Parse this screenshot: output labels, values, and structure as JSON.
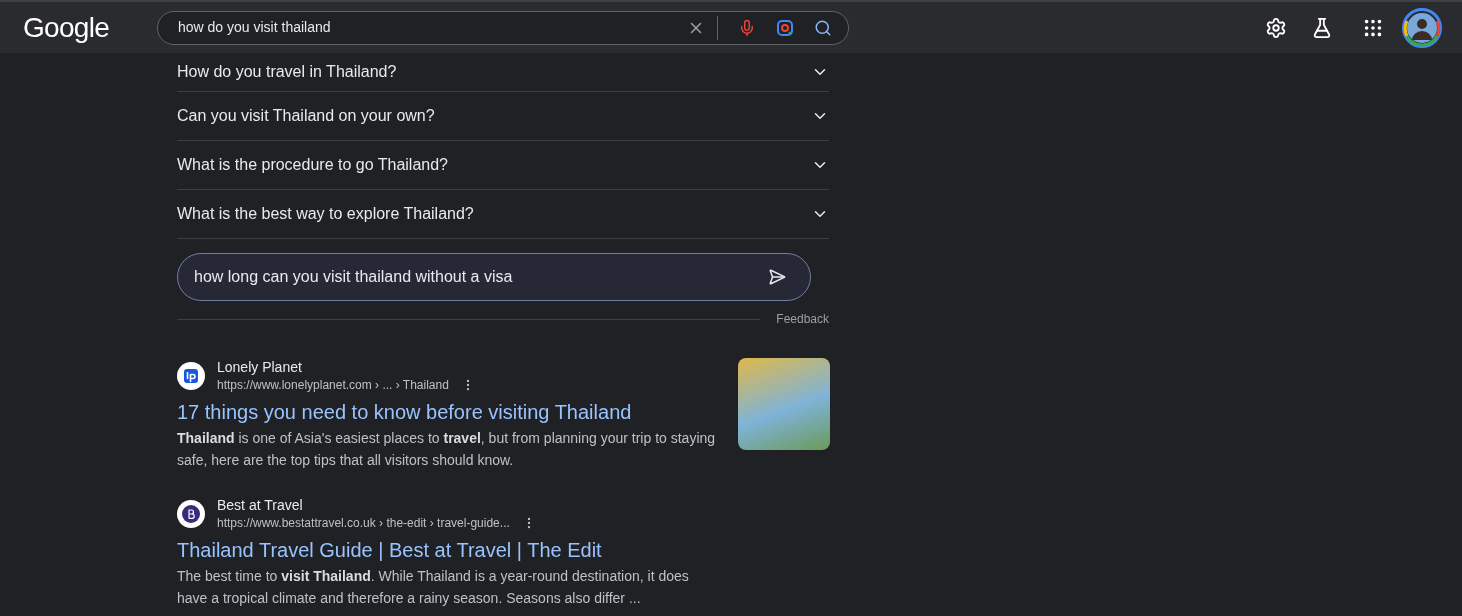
{
  "header": {
    "logo": "Google",
    "search": {
      "value": "how do you visit thailand"
    }
  },
  "questions": [
    {
      "text": "How do you travel in Thailand?",
      "expanded": false
    },
    {
      "text": "Can you visit Thailand on your own?",
      "expanded": false
    },
    {
      "text": "What is the procedure to go Thailand?",
      "expanded": false
    },
    {
      "text": "What is the best way to explore Thailand?",
      "expanded": false
    }
  ],
  "follow_up": {
    "value": "how long can you visit thailand without a visa"
  },
  "feedback": "Feedback",
  "results": [
    {
      "kind": "lp",
      "site": "Lonely Planet",
      "url": "https://www.lonelyplanet.com › ... › Thailand",
      "title": "17 things you need to know before visiting Thailand",
      "snippet": "**Thailand** is one of Asia's easiest places to **travel**, but from planning your trip to staying safe, here are the top tips that all visitors should know.",
      "has_image": true
    },
    {
      "kind": "bat",
      "site": "Best at Travel",
      "url": "https://www.bestattravel.co.uk › the-edit › travel-guide...",
      "title": "Thailand Travel Guide | Best at Travel | The Edit",
      "snippet": "The best time to **visit Thailand**. While Thailand is a year-round destination, it does have a tropical climate and therefore a rainy season. Seasons also differ ...",
      "has_image": false
    }
  ]
}
